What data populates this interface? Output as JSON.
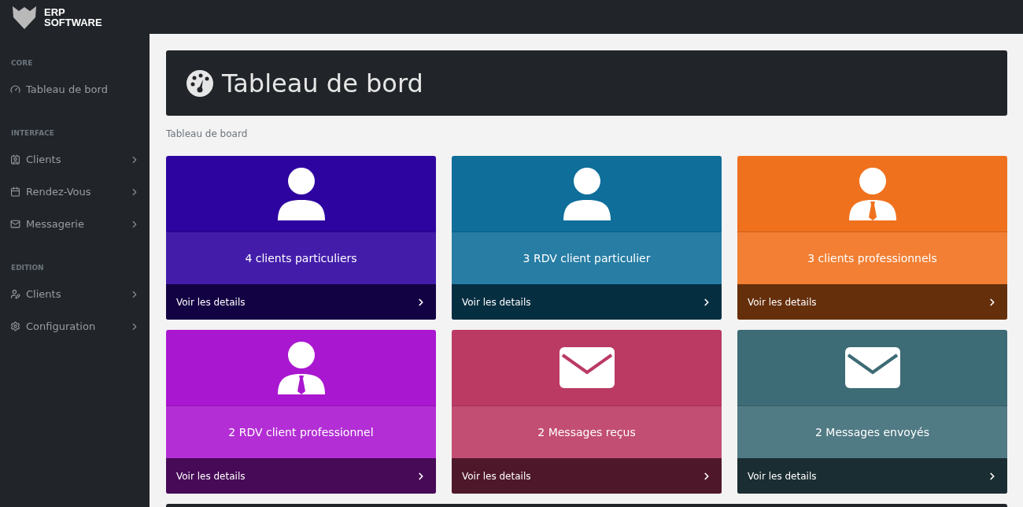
{
  "brand": {
    "lines": [
      "ERP",
      "SOFTWARE"
    ]
  },
  "sidebar": {
    "sections": [
      {
        "heading": "CORE",
        "items": [
          {
            "label": "Tableau de bord",
            "kind": "gauge",
            "expandable": false
          }
        ]
      },
      {
        "heading": "INTERFACE",
        "items": [
          {
            "label": "Clients",
            "kind": "contact",
            "expandable": true
          },
          {
            "label": "Rendez-Vous",
            "kind": "calendar",
            "expandable": true
          },
          {
            "label": "Messagerie",
            "kind": "mail",
            "expandable": true
          }
        ]
      },
      {
        "heading": "EDITION",
        "items": [
          {
            "label": "Clients",
            "kind": "useredit",
            "expandable": true
          },
          {
            "label": "Configuration",
            "kind": "gear",
            "expandable": true
          }
        ]
      }
    ]
  },
  "page": {
    "title": "Tableau de bord",
    "breadcrumb": "Tableau de board"
  },
  "cards": [
    {
      "kind": "user",
      "color": "#2e04a0",
      "label": "4 clients particuliers",
      "link": "Voir les details"
    },
    {
      "kind": "user",
      "color": "#0f6e9a",
      "label": "3 RDV client particulier",
      "link": "Voir les details"
    },
    {
      "kind": "tie",
      "color": "#f0711d",
      "label": "3 clients professionnels",
      "link": "Voir les details"
    },
    {
      "kind": "tie",
      "color": "#aa17d0",
      "label": "2 RDV client professionnel",
      "link": "Voir les details"
    },
    {
      "kind": "envelope",
      "color": "#bb3a64",
      "label": "2 Messages reçus",
      "link": "Voir les details"
    },
    {
      "kind": "envelope",
      "color": "#3d6b76",
      "label": "2 Messages envoyés",
      "link": "Voir les details"
    }
  ]
}
